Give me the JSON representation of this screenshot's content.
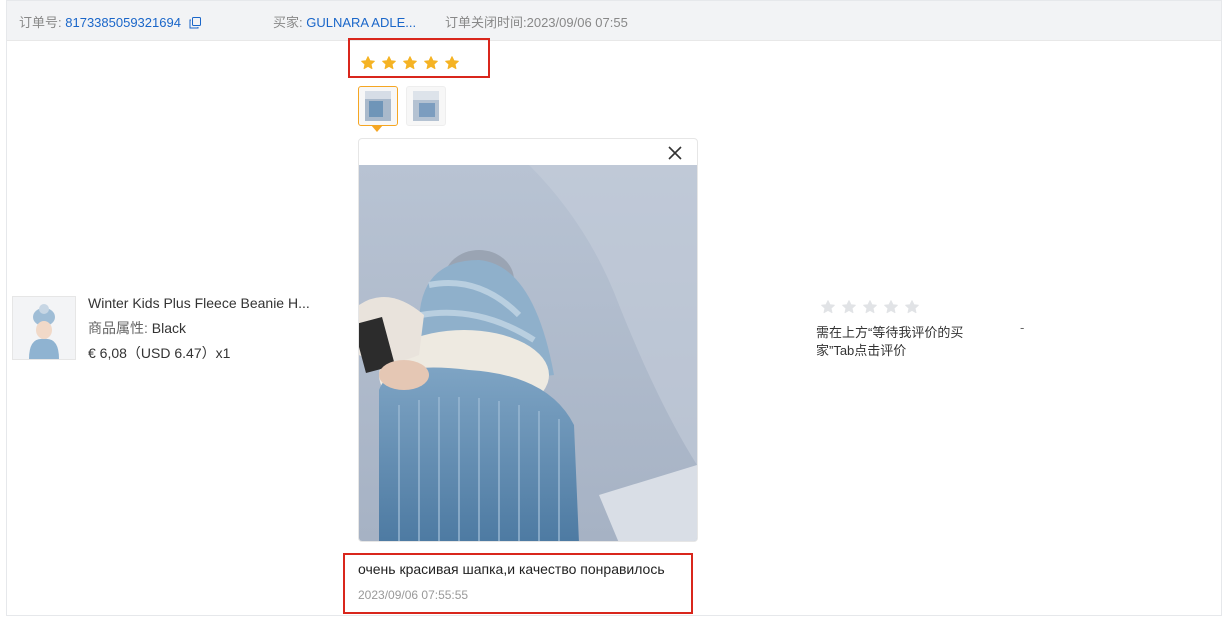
{
  "header": {
    "order_label": "订单号:",
    "order_id": "8173385059321694",
    "buyer_label": "买家:",
    "buyer_name": "GULNARA ADLE...",
    "closed_text": "订单关闭时间:2023/09/06 07:55"
  },
  "product": {
    "title": "Winter Kids Plus Fleece Beanie H...",
    "attr_label": "商品属性:",
    "attr_value": "Black",
    "price": "€ 6,08（USD  6.47）x1"
  },
  "review": {
    "rating": 5,
    "max_rating": 5,
    "star_color": "#f5b324",
    "images": [
      "review-photo-1",
      "review-photo-2"
    ],
    "active_image": 0,
    "comment": "очень красивая шапка,и качество понравилось",
    "time": "2023/09/06 07:55:55"
  },
  "seller": {
    "rating": 0,
    "max_rating": 5,
    "note": "需在上方“等待我评价的买家”Tab点击评价",
    "dash": "-"
  },
  "colors": {
    "link": "#1a66c9",
    "highlight_border": "#d9261c",
    "active_thumb": "#f5a623"
  }
}
